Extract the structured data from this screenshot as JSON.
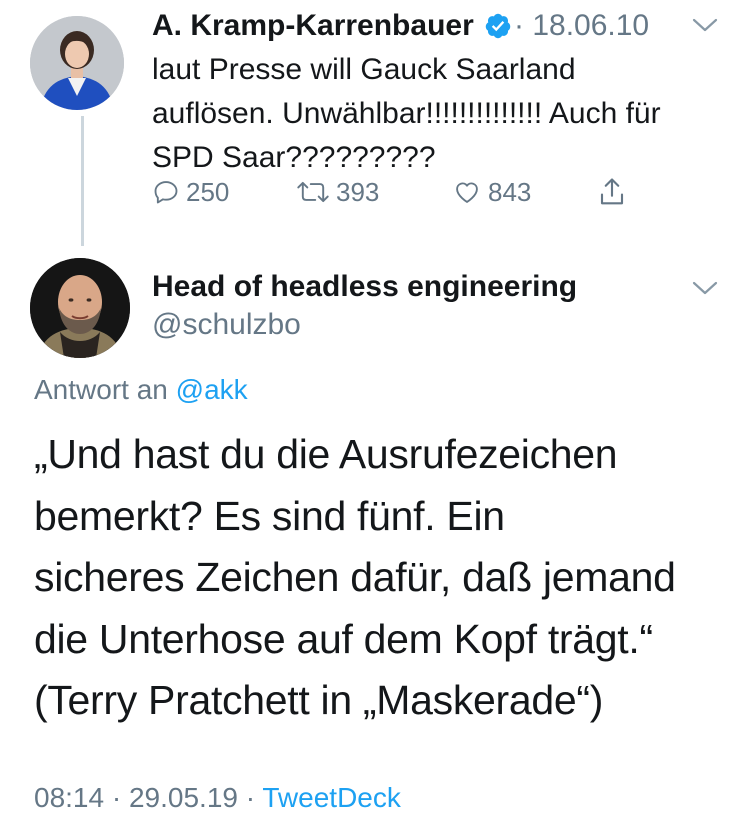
{
  "tweet1": {
    "author_name": "A. Kramp-Karrenbauer",
    "separator": "·",
    "date": "18.06.10",
    "text": "laut Presse will Gauck  Saarland\nauflösen. Unwählbar!!!!!!!!!!!!!! Auch für\nSPD Saar?????????",
    "actions": {
      "replies": "250",
      "retweets": "393",
      "likes": "843"
    },
    "icons": [
      "verified-badge-icon",
      "chevron-down-icon",
      "reply-icon",
      "retweet-icon",
      "like-icon",
      "share-icon"
    ]
  },
  "tweet2": {
    "author_name": "Head of headless engineering",
    "handle": "@schulzbo",
    "reply_prefix": "Antwort an",
    "reply_to": "@akk",
    "text": "„Und hast du die Ausrufezeichen\nbemerkt? Es sind fünf. Ein\nsicheres Zeichen dafür, daß jemand\ndie Unterhose auf dem Kopf trägt.“\n(Terry Pratchett in „Maskerade“)",
    "time": "08:14",
    "sep1": "·",
    "date": "29.05.19",
    "sep2": "·",
    "source": "TweetDeck"
  },
  "colors": {
    "text": "#14171a",
    "muted": "#657786",
    "link": "#1da1f2",
    "thread_line": "#ccd6dd",
    "verified": "#1da1f2"
  }
}
